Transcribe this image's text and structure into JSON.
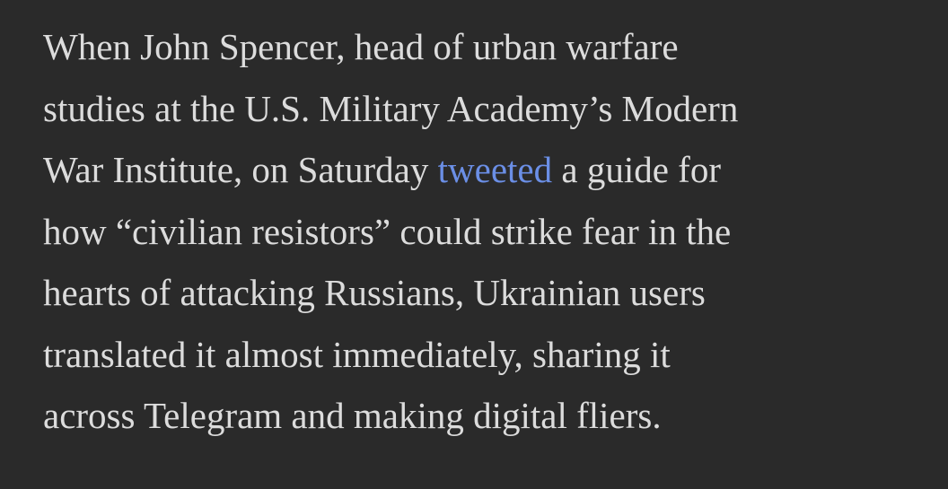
{
  "article": {
    "lines": [
      {
        "text": "When John Spencer, head of urban warfare"
      },
      {
        "text": "studies at the U.S. Military Academy’s Modern"
      },
      {
        "before": "War Institute, on Saturday ",
        "link": "tweeted",
        "after": " a guide for"
      },
      {
        "text": "how “civilian resistors” could strike fear in the"
      },
      {
        "text": "hearts of attacking Russians, Ukrainian users"
      },
      {
        "text": "translated it almost immediately, sharing it"
      },
      {
        "text": "across Telegram and making digital fliers."
      }
    ]
  },
  "colors": {
    "background": "#2a2a2a",
    "text": "#dcdcdc",
    "link": "#6b8fe6"
  }
}
